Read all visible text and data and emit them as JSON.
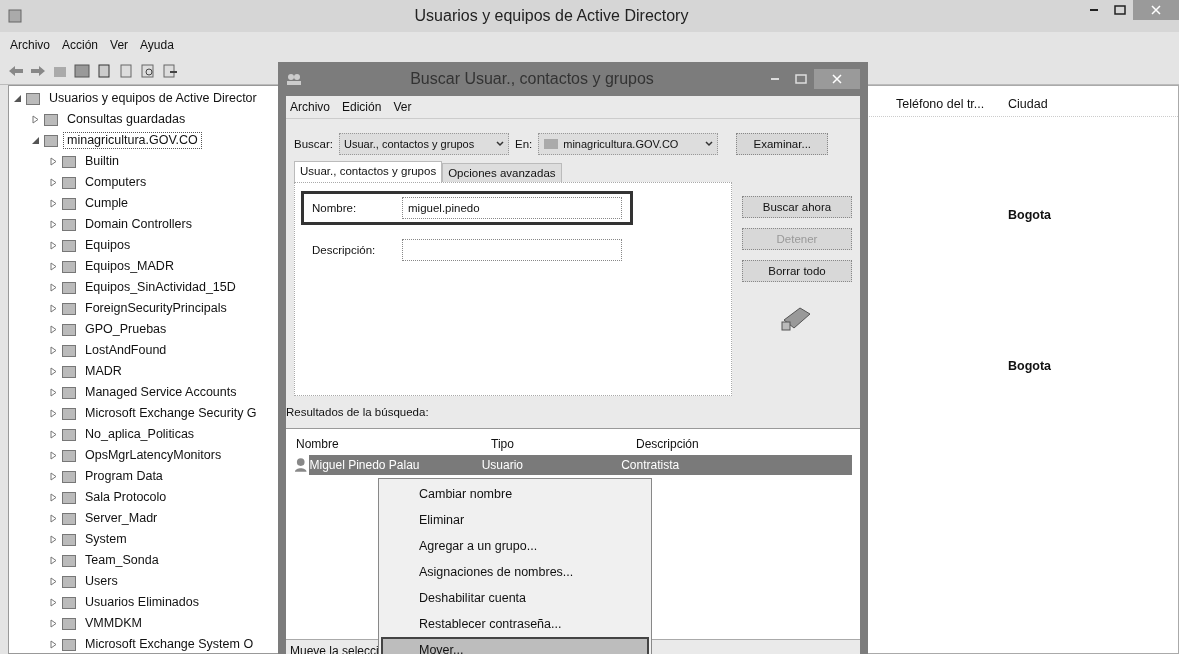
{
  "window": {
    "title": "Usuarios y equipos de Active Directory"
  },
  "menu": [
    "Archivo",
    "Acción",
    "Ver",
    "Ayuda"
  ],
  "tree": {
    "label": "Usuarios y equipos de Active Director",
    "selected": false,
    "expanded": true,
    "children": [
      {
        "label": "Consultas guardadas",
        "selected": false,
        "expanded": false
      },
      {
        "label": "minagricultura.GOV.CO",
        "selected": true,
        "expanded": true,
        "children": [
          {
            "label": "Builtin",
            "selected": false,
            "expanded": false
          },
          {
            "label": "Computers",
            "selected": false,
            "expanded": false
          },
          {
            "label": "Cumple",
            "selected": false,
            "expanded": false
          },
          {
            "label": "Domain Controllers",
            "selected": false,
            "expanded": false
          },
          {
            "label": "Equipos",
            "selected": false,
            "expanded": false
          },
          {
            "label": "Equipos_MADR",
            "selected": false,
            "expanded": false
          },
          {
            "label": "Equipos_SinActividad_15D",
            "selected": false,
            "expanded": false
          },
          {
            "label": "ForeignSecurityPrincipals",
            "selected": false,
            "expanded": false
          },
          {
            "label": "GPO_Pruebas",
            "selected": false,
            "expanded": false
          },
          {
            "label": "LostAndFound",
            "selected": false,
            "expanded": false
          },
          {
            "label": "MADR",
            "selected": false,
            "expanded": false
          },
          {
            "label": "Managed Service Accounts",
            "selected": false,
            "expanded": false
          },
          {
            "label": "Microsoft Exchange Security G",
            "selected": false,
            "expanded": false
          },
          {
            "label": "No_aplica_Politicas",
            "selected": false,
            "expanded": false
          },
          {
            "label": "OpsMgrLatencyMonitors",
            "selected": false,
            "expanded": false
          },
          {
            "label": "Program Data",
            "selected": false,
            "expanded": false
          },
          {
            "label": "Sala Protocolo",
            "selected": false,
            "expanded": false
          },
          {
            "label": "Server_Madr",
            "selected": false,
            "expanded": false
          },
          {
            "label": "System",
            "selected": false,
            "expanded": false
          },
          {
            "label": "Team_Sonda",
            "selected": false,
            "expanded": false
          },
          {
            "label": "Users",
            "selected": false,
            "expanded": false
          },
          {
            "label": "Usuarios Eliminados",
            "selected": false,
            "expanded": false
          },
          {
            "label": "VMMDKM",
            "selected": false,
            "expanded": false
          },
          {
            "label": "Microsoft Exchange System O",
            "selected": false,
            "expanded": false
          }
        ]
      }
    ]
  },
  "list": {
    "columns": [
      "Teléfono del tr...",
      "Ciudad"
    ],
    "rows": [
      {
        "ciudad": null
      },
      {
        "ciudad": null
      },
      {
        "ciudad": null
      },
      {
        "ciudad": null
      },
      {
        "ciudad": "Bogota"
      },
      {
        "ciudad": null
      },
      {
        "ciudad": null
      },
      {
        "ciudad": null
      },
      {
        "ciudad": null
      },
      {
        "ciudad": null
      },
      {
        "ciudad": null
      },
      {
        "ciudad": "Bogota"
      }
    ]
  },
  "dialog": {
    "title": "Buscar Usuar., contactos y grupos",
    "menu": [
      "Archivo",
      "Edición",
      "Ver"
    ],
    "find": {
      "label": "Buscar:",
      "value": "Usuar., contactos y grupos"
    },
    "in": {
      "label": "En:",
      "value": "minagricultura.GOV.CO"
    },
    "browse": "Examinar...",
    "tabs": [
      {
        "label": "Usuar., contactos y grupos",
        "selected": true
      },
      {
        "label": "Opciones avanzadas",
        "selected": false
      }
    ],
    "fields": [
      {
        "label": "Nombre:",
        "value": "miguel.pinedo",
        "focused": true
      },
      {
        "label": "Descripción:",
        "focused": false
      }
    ],
    "buttons": [
      {
        "label": "Buscar ahora",
        "disabled": false
      },
      {
        "label": "Detener",
        "disabled": true
      },
      {
        "label": "Borrar todo",
        "disabled": false
      }
    ],
    "results_label": "Resultados de la búsqueda:",
    "results": {
      "columns": [
        "Nombre",
        "Tipo",
        "Descripción"
      ],
      "rows": [
        {
          "name": "Miguel Pinedo Palau",
          "type": "Usuario",
          "description": "Contratista",
          "selected": true
        }
      ]
    },
    "status": "Mueve la selecci"
  },
  "context_menu": [
    {
      "label": "Cambiar nombre",
      "selected": false
    },
    {
      "label": "Eliminar",
      "selected": false
    },
    {
      "label": "Agregar a un grupo...",
      "selected": false
    },
    {
      "label": "Asignaciones de nombres...",
      "selected": false
    },
    {
      "label": "Deshabilitar cuenta",
      "selected": false
    },
    {
      "label": "Restablecer contraseña...",
      "selected": false
    },
    {
      "label": "Mover...",
      "selected": true
    }
  ]
}
